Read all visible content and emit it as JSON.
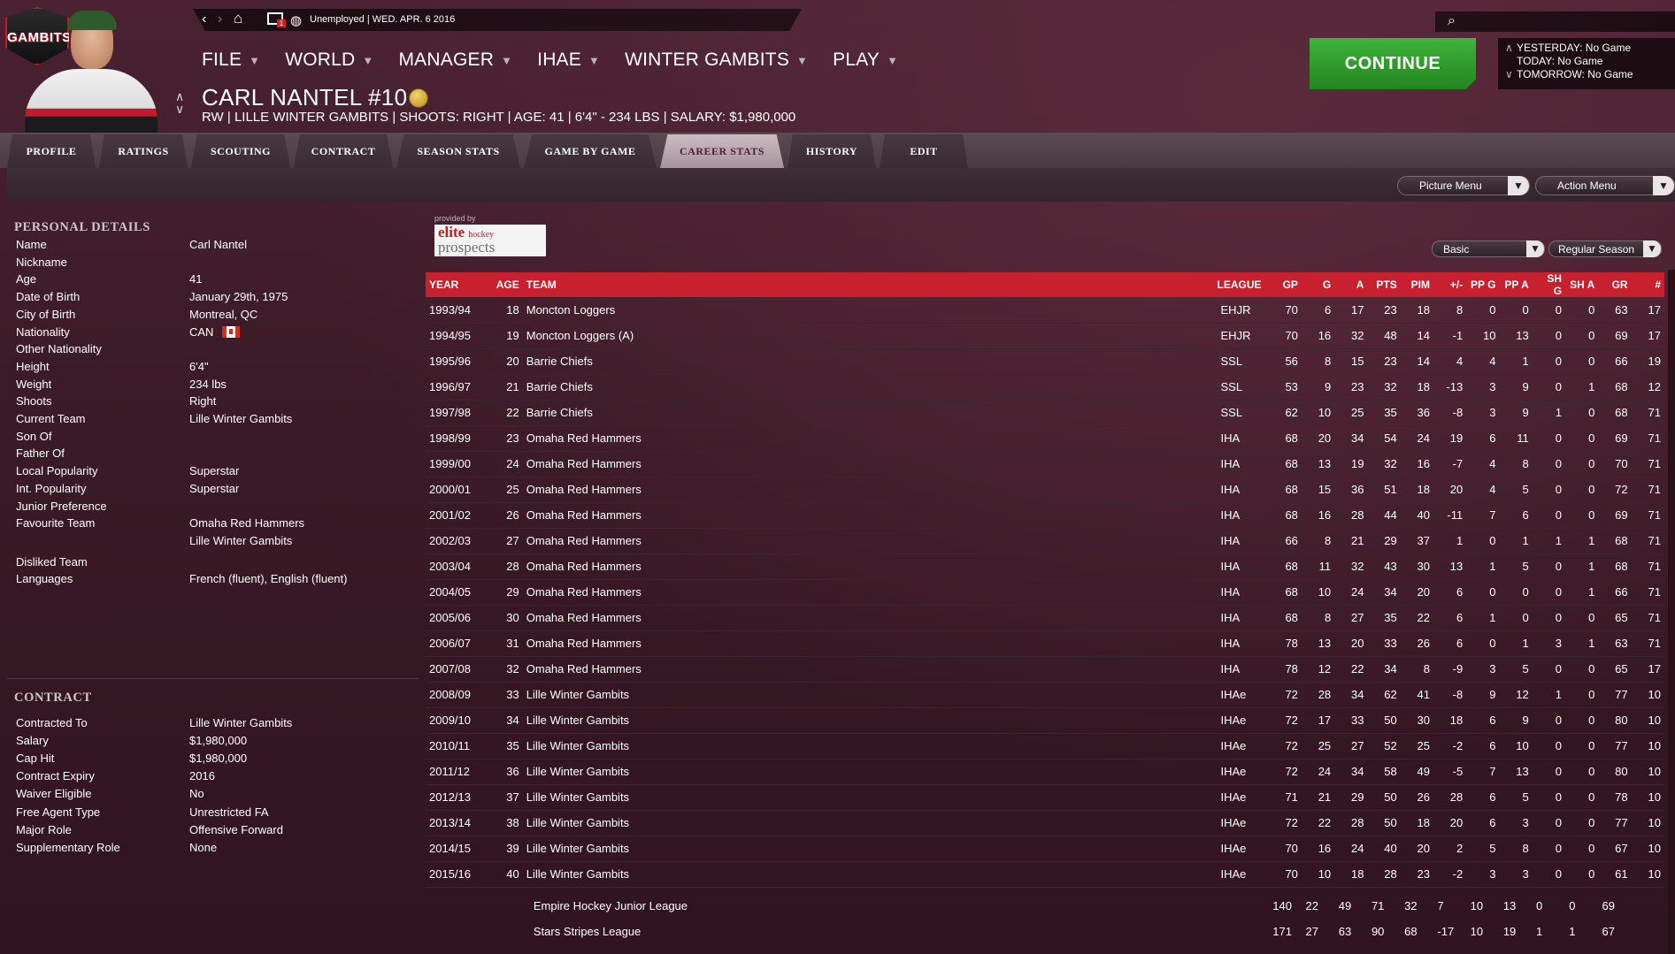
{
  "nav": {
    "status": "Unemployed |  WED. APR. 6 2016",
    "mail_count": "1"
  },
  "logo_text": "GAMBITS",
  "menu": [
    {
      "label": "FILE"
    },
    {
      "label": "WORLD"
    },
    {
      "label": "MANAGER"
    },
    {
      "label": "IHAE"
    },
    {
      "label": "WINTER GAMBITS"
    },
    {
      "label": "PLAY"
    }
  ],
  "player": {
    "name": "CARL NANTEL #10",
    "info": "RW | LILLE WINTER GAMBITS | SHOOTS: RIGHT | AGE: 41 | 6'4\" - 234 LBS | SALARY: $1,980,000"
  },
  "continue_label": "CONTINUE",
  "schedule": {
    "yesterday": "YESTERDAY: No Game",
    "today": "TODAY: No Game",
    "tomorrow": "TOMORROW: No Game"
  },
  "tabs": [
    "PROFILE",
    "RATINGS",
    "SCOUTING",
    "CONTRACT",
    "SEASON STATS",
    "GAME BY GAME",
    "CAREER STATS",
    "HISTORY",
    "EDIT"
  ],
  "active_tab": "CAREER STATS",
  "picture_menu": "Picture Menu",
  "action_menu": "Action Menu",
  "personal": {
    "title": "PERSONAL DETAILS",
    "rows": [
      {
        "label": "Name",
        "value": "Carl Nantel"
      },
      {
        "label": "Nickname",
        "value": ""
      },
      {
        "label": "Age",
        "value": "41"
      },
      {
        "label": "Date of Birth",
        "value": "January 29th, 1975"
      },
      {
        "label": "City of Birth",
        "value": "Montreal, QC"
      },
      {
        "label": "Nationality",
        "value": "CAN"
      },
      {
        "label": "Other Nationality",
        "value": ""
      },
      {
        "label": "Height",
        "value": "6'4\""
      },
      {
        "label": "Weight",
        "value": "234 lbs"
      },
      {
        "label": "Shoots",
        "value": "Right"
      },
      {
        "label": "Current Team",
        "value": "Lille Winter Gambits"
      },
      {
        "label": "Son Of",
        "value": ""
      },
      {
        "label": "Father Of",
        "value": ""
      },
      {
        "label": "Local Popularity",
        "value": "Superstar"
      },
      {
        "label": "Int. Popularity",
        "value": "Superstar"
      },
      {
        "label": "Junior Preference",
        "value": ""
      },
      {
        "label": "Favourite Team",
        "value": "Omaha Red Hammers"
      },
      {
        "label": "",
        "value": "Lille Winter Gambits"
      },
      {
        "label": "Disliked Team",
        "value": ""
      },
      {
        "label": "Languages",
        "value": "French (fluent), English (fluent)"
      }
    ]
  },
  "contract": {
    "title": "CONTRACT",
    "rows": [
      {
        "label": "Contracted To",
        "value": "Lille Winter Gambits"
      },
      {
        "label": "Salary",
        "value": "$1,980,000"
      },
      {
        "label": "Cap Hit",
        "value": "$1,980,000"
      },
      {
        "label": "Contract Expiry",
        "value": "2016"
      },
      {
        "label": "Waiver Eligible",
        "value": "No"
      },
      {
        "label": "Free Agent Type",
        "value": "Unrestricted FA"
      },
      {
        "label": "Major Role",
        "value": "Offensive Forward"
      },
      {
        "label": "Supplementary Role",
        "value": "None"
      }
    ]
  },
  "ep": {
    "provided": "provided by",
    "elite": "elite",
    "hockey": "hockey",
    "prospects": "prospects"
  },
  "filter_view": "Basic",
  "filter_season": "Regular Season",
  "columns": [
    "YEAR",
    "AGE",
    "TEAM",
    "LEAGUE",
    "GP",
    "G",
    "A",
    "PTS",
    "PIM",
    "+/-",
    "PP G",
    "PP A",
    "SH G",
    "SH A",
    "GR",
    "#"
  ],
  "rows": [
    [
      "1993/94",
      "18",
      "Moncton Loggers",
      "EHJR",
      "70",
      "6",
      "17",
      "23",
      "18",
      "8",
      "0",
      "0",
      "0",
      "0",
      "63",
      "17"
    ],
    [
      "1994/95",
      "19",
      "Moncton Loggers (A)",
      "EHJR",
      "70",
      "16",
      "32",
      "48",
      "14",
      "-1",
      "10",
      "13",
      "0",
      "0",
      "69",
      "17"
    ],
    [
      "1995/96",
      "20",
      "Barrie Chiefs",
      "SSL",
      "56",
      "8",
      "15",
      "23",
      "14",
      "4",
      "4",
      "1",
      "0",
      "0",
      "66",
      "19"
    ],
    [
      "1996/97",
      "21",
      "Barrie Chiefs",
      "SSL",
      "53",
      "9",
      "23",
      "32",
      "18",
      "-13",
      "3",
      "9",
      "0",
      "1",
      "68",
      "12"
    ],
    [
      "1997/98",
      "22",
      "Barrie Chiefs",
      "SSL",
      "62",
      "10",
      "25",
      "35",
      "36",
      "-8",
      "3",
      "9",
      "1",
      "0",
      "68",
      "71"
    ],
    [
      "1998/99",
      "23",
      "Omaha Red Hammers",
      "IHA",
      "68",
      "20",
      "34",
      "54",
      "24",
      "19",
      "6",
      "11",
      "0",
      "0",
      "69",
      "71"
    ],
    [
      "1999/00",
      "24",
      "Omaha Red Hammers",
      "IHA",
      "68",
      "13",
      "19",
      "32",
      "16",
      "-7",
      "4",
      "8",
      "0",
      "0",
      "70",
      "71"
    ],
    [
      "2000/01",
      "25",
      "Omaha Red Hammers",
      "IHA",
      "68",
      "15",
      "36",
      "51",
      "18",
      "20",
      "4",
      "5",
      "0",
      "0",
      "72",
      "71"
    ],
    [
      "2001/02",
      "26",
      "Omaha Red Hammers",
      "IHA",
      "68",
      "16",
      "28",
      "44",
      "40",
      "-11",
      "7",
      "6",
      "0",
      "0",
      "69",
      "71"
    ],
    [
      "2002/03",
      "27",
      "Omaha Red Hammers",
      "IHA",
      "66",
      "8",
      "21",
      "29",
      "37",
      "1",
      "0",
      "1",
      "1",
      "1",
      "68",
      "71"
    ],
    [
      "2003/04",
      "28",
      "Omaha Red Hammers",
      "IHA",
      "68",
      "11",
      "32",
      "43",
      "30",
      "13",
      "1",
      "5",
      "0",
      "1",
      "68",
      "71"
    ],
    [
      "2004/05",
      "29",
      "Omaha Red Hammers",
      "IHA",
      "68",
      "10",
      "24",
      "34",
      "20",
      "6",
      "0",
      "0",
      "0",
      "1",
      "66",
      "71"
    ],
    [
      "2005/06",
      "30",
      "Omaha Red Hammers",
      "IHA",
      "68",
      "8",
      "27",
      "35",
      "22",
      "6",
      "1",
      "0",
      "0",
      "0",
      "65",
      "71"
    ],
    [
      "2006/07",
      "31",
      "Omaha Red Hammers",
      "IHA",
      "78",
      "13",
      "20",
      "33",
      "26",
      "6",
      "0",
      "1",
      "3",
      "1",
      "63",
      "71"
    ],
    [
      "2007/08",
      "32",
      "Omaha Red Hammers",
      "IHA",
      "78",
      "12",
      "22",
      "34",
      "8",
      "-9",
      "3",
      "5",
      "0",
      "0",
      "65",
      "17"
    ],
    [
      "2008/09",
      "33",
      "Lille Winter Gambits",
      "IHAe",
      "72",
      "28",
      "34",
      "62",
      "41",
      "-8",
      "9",
      "12",
      "1",
      "0",
      "77",
      "10"
    ],
    [
      "2009/10",
      "34",
      "Lille Winter Gambits",
      "IHAe",
      "72",
      "17",
      "33",
      "50",
      "30",
      "18",
      "6",
      "9",
      "0",
      "0",
      "80",
      "10"
    ],
    [
      "2010/11",
      "35",
      "Lille Winter Gambits",
      "IHAe",
      "72",
      "25",
      "27",
      "52",
      "25",
      "-2",
      "6",
      "10",
      "0",
      "0",
      "77",
      "10"
    ],
    [
      "2011/12",
      "36",
      "Lille Winter Gambits",
      "IHAe",
      "72",
      "24",
      "34",
      "58",
      "49",
      "-5",
      "7",
      "13",
      "0",
      "0",
      "80",
      "10"
    ],
    [
      "2012/13",
      "37",
      "Lille Winter Gambits",
      "IHAe",
      "71",
      "21",
      "29",
      "50",
      "26",
      "28",
      "6",
      "5",
      "0",
      "0",
      "78",
      "10"
    ],
    [
      "2013/14",
      "38",
      "Lille Winter Gambits",
      "IHAe",
      "72",
      "22",
      "28",
      "50",
      "18",
      "20",
      "6",
      "3",
      "0",
      "0",
      "77",
      "10"
    ],
    [
      "2014/15",
      "39",
      "Lille Winter Gambits",
      "IHAe",
      "70",
      "16",
      "24",
      "40",
      "20",
      "2",
      "5",
      "8",
      "0",
      "0",
      "67",
      "10"
    ],
    [
      "2015/16",
      "40",
      "Lille Winter Gambits",
      "IHAe",
      "70",
      "10",
      "18",
      "28",
      "23",
      "-2",
      "3",
      "3",
      "0",
      "0",
      "61",
      "10"
    ]
  ],
  "totals": [
    [
      "Empire Hockey Junior League",
      "140",
      "22",
      "49",
      "71",
      "32",
      "7",
      "10",
      "13",
      "0",
      "0",
      "69"
    ],
    [
      "Stars Stripes League",
      "171",
      "27",
      "63",
      "90",
      "68",
      "-17",
      "10",
      "19",
      "1",
      "1",
      "67"
    ]
  ]
}
